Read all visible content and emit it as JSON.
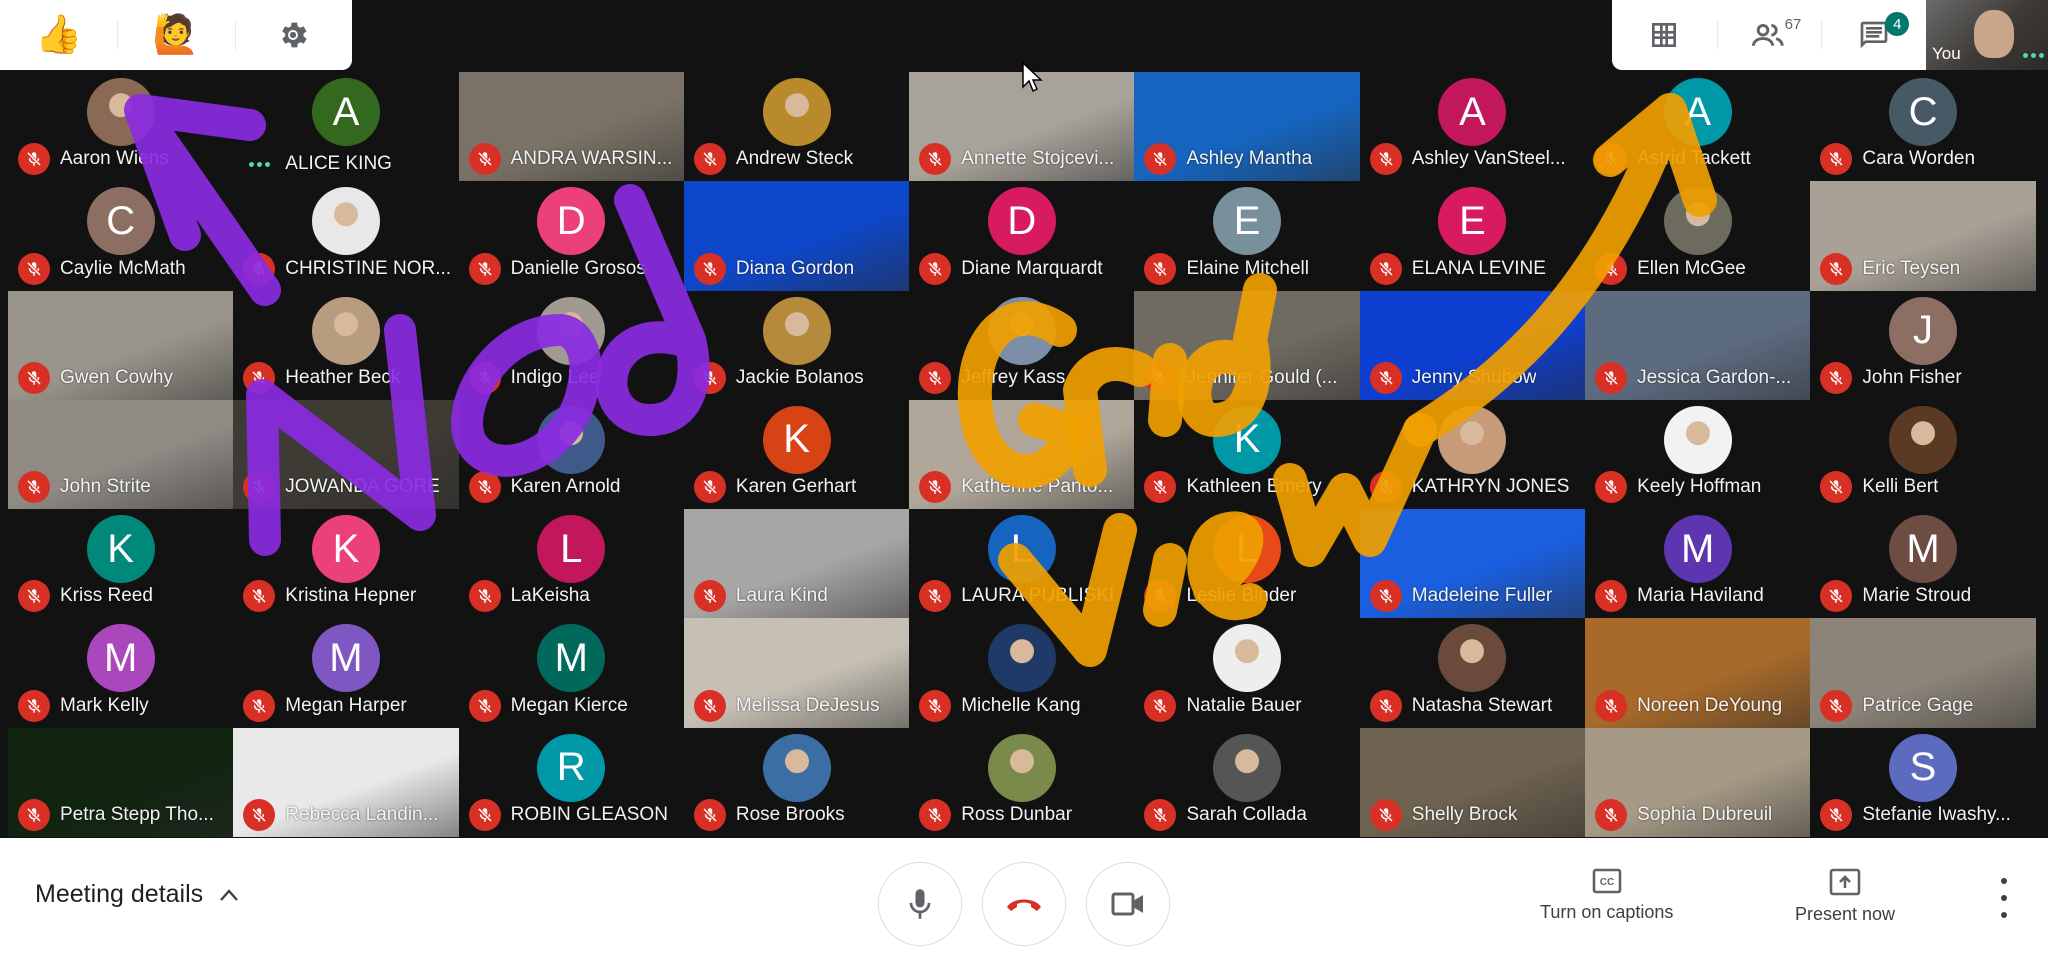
{
  "top_left_toolbar": {
    "buttons": [
      {
        "name": "thumbs-up",
        "glyph": "👍"
      },
      {
        "name": "raise-hand",
        "glyph": "🙋"
      },
      {
        "name": "settings",
        "glyph": "⚙"
      }
    ]
  },
  "top_right_toolbar": {
    "layout_icon": "grid-icon",
    "participants_count": "67",
    "chat_badge": "4",
    "self_label": "You"
  },
  "participants": [
    {
      "name": "Aaron Wiens",
      "type": "avatar-photo",
      "color": "#8a6a55",
      "muted": true
    },
    {
      "name": "ALICE KING",
      "type": "avatar-letter",
      "letter": "A",
      "color": "#33691e",
      "muted": false,
      "speaking": true
    },
    {
      "name": "ANDRA WARSIN...",
      "type": "video",
      "color": "#7a7266",
      "muted": true
    },
    {
      "name": "Andrew Steck",
      "type": "avatar-photo",
      "color": "#b88a2c",
      "muted": true
    },
    {
      "name": "Annette Stojcevi...",
      "type": "video",
      "color": "#a8a39a",
      "muted": true
    },
    {
      "name": "Ashley Mantha",
      "type": "video",
      "color": "#1565c0",
      "muted": true
    },
    {
      "name": "Ashley VanSteel...",
      "type": "avatar-letter",
      "letter": "A",
      "color": "#c2185b",
      "muted": true
    },
    {
      "name": "Astrid Tackett",
      "type": "avatar-letter",
      "letter": "A",
      "color": "#0097a7",
      "muted": true
    },
    {
      "name": "Cara Worden",
      "type": "avatar-letter",
      "letter": "C",
      "color": "#455a64",
      "muted": true
    },
    {
      "name": "Caylie McMath",
      "type": "avatar-letter",
      "letter": "C",
      "color": "#8d6e63",
      "muted": true
    },
    {
      "name": "CHRISTINE NOR...",
      "type": "avatar-photo",
      "color": "#e8e8e8",
      "muted": true
    },
    {
      "name": "Danielle Grosos",
      "type": "avatar-letter",
      "letter": "D",
      "color": "#ec407a",
      "muted": true
    },
    {
      "name": "Diana Gordon",
      "type": "video",
      "color": "#0d47c9",
      "muted": true
    },
    {
      "name": "Diane Marquardt",
      "type": "avatar-letter",
      "letter": "D",
      "color": "#d81b60",
      "muted": true
    },
    {
      "name": "Elaine Mitchell",
      "type": "avatar-letter",
      "letter": "E",
      "color": "#78909c",
      "muted": true
    },
    {
      "name": "ELANA LEVINE",
      "type": "avatar-letter",
      "letter": "E",
      "color": "#d81b60",
      "muted": true
    },
    {
      "name": "Ellen McGee",
      "type": "avatar-photo",
      "color": "#6d6a5e",
      "muted": true
    },
    {
      "name": "Eric Teysen",
      "type": "video",
      "color": "#a9a196",
      "muted": true
    },
    {
      "name": "Gwen Cowhy",
      "type": "video",
      "color": "#9a958c",
      "muted": true
    },
    {
      "name": "Heather Beck",
      "type": "avatar-photo",
      "color": "#b89c80",
      "muted": true
    },
    {
      "name": "Indigo Lee",
      "type": "avatar-photo",
      "color": "#a09a90",
      "muted": true
    },
    {
      "name": "Jackie Bolanos",
      "type": "avatar-photo",
      "color": "#b58a3a",
      "muted": true
    },
    {
      "name": "Jeffrey Kass",
      "type": "avatar-photo",
      "color": "#7d8fa8",
      "muted": true
    },
    {
      "name": "Jennifer Gould (...",
      "type": "video",
      "color": "#6f6a62",
      "muted": true
    },
    {
      "name": "Jenny Shubow",
      "type": "video",
      "color": "#0d3fd1",
      "muted": true
    },
    {
      "name": "Jessica Gardon-...",
      "type": "video",
      "color": "#5d6b80",
      "muted": true
    },
    {
      "name": "John Fisher",
      "type": "avatar-letter",
      "letter": "J",
      "color": "#8d6e63",
      "muted": true
    },
    {
      "name": "John Strite",
      "type": "video",
      "color": "#8f8a84",
      "muted": true
    },
    {
      "name": "JOWANDA GORE",
      "type": "video",
      "color": "#3e3a34",
      "muted": true
    },
    {
      "name": "Karen Arnold",
      "type": "avatar-photo",
      "color": "#3f5a8a",
      "muted": true
    },
    {
      "name": "Karen Gerhart",
      "type": "avatar-letter",
      "letter": "K",
      "color": "#d84315",
      "muted": true
    },
    {
      "name": "Katherine Panto...",
      "type": "video",
      "color": "#b0a79a",
      "muted": true
    },
    {
      "name": "Kathleen Emery",
      "type": "avatar-letter",
      "letter": "K",
      "color": "#0097a7",
      "muted": true
    },
    {
      "name": "KATHRYN JONES",
      "type": "avatar-photo",
      "color": "#c79a78",
      "muted": true
    },
    {
      "name": "Keely Hoffman",
      "type": "avatar-photo",
      "color": "#f2f2f2",
      "muted": true
    },
    {
      "name": "Kelli Bert",
      "type": "avatar-photo",
      "color": "#5a3a22",
      "muted": true
    },
    {
      "name": "Kriss Reed",
      "type": "avatar-letter",
      "letter": "K",
      "color": "#00897b",
      "muted": true
    },
    {
      "name": "Kristina Hepner",
      "type": "avatar-letter",
      "letter": "K",
      "color": "#ec407a",
      "muted": true
    },
    {
      "name": "LaKeisha",
      "type": "avatar-letter",
      "letter": "L",
      "color": "#c2185b",
      "muted": true
    },
    {
      "name": "Laura Kind",
      "type": "video",
      "color": "#a7a6a4",
      "muted": true
    },
    {
      "name": "LAURA PUBLISKI",
      "type": "avatar-letter",
      "letter": "L",
      "color": "#1565c0",
      "muted": true
    },
    {
      "name": "Leslie Binder",
      "type": "avatar-letter",
      "letter": "L",
      "color": "#e64a19",
      "muted": true
    },
    {
      "name": "Madeleine Fuller",
      "type": "video",
      "color": "#1a5fe0",
      "muted": true
    },
    {
      "name": "Maria Haviland",
      "type": "avatar-letter",
      "letter": "M",
      "color": "#5e35b1",
      "muted": true
    },
    {
      "name": "Marie Stroud",
      "type": "avatar-letter",
      "letter": "M",
      "color": "#6d4c41",
      "muted": true
    },
    {
      "name": "Mark Kelly",
      "type": "avatar-letter",
      "letter": "M",
      "color": "#ab47bc",
      "muted": true
    },
    {
      "name": "Megan Harper",
      "type": "avatar-letter",
      "letter": "M",
      "color": "#7e57c2",
      "muted": true
    },
    {
      "name": "Megan Kierce",
      "type": "avatar-letter",
      "letter": "M",
      "color": "#00695c",
      "muted": true
    },
    {
      "name": "Melissa DeJesus",
      "type": "video",
      "color": "#c6c0b4",
      "muted": true
    },
    {
      "name": "Michelle Kang",
      "type": "avatar-photo",
      "color": "#1f3a66",
      "muted": true
    },
    {
      "name": "Natalie Bauer",
      "type": "avatar-photo",
      "color": "#eeeeee",
      "muted": true
    },
    {
      "name": "Natasha Stewart",
      "type": "avatar-photo",
      "color": "#6a4a3a",
      "muted": true
    },
    {
      "name": "Noreen DeYoung",
      "type": "video",
      "color": "#a86a2a",
      "muted": true
    },
    {
      "name": "Patrice Gage",
      "type": "video",
      "color": "#8c8478",
      "muted": true
    },
    {
      "name": "Petra Stepp Tho...",
      "type": "video",
      "color": "#102410",
      "muted": true
    },
    {
      "name": "Rebecca Landin...",
      "type": "video",
      "color": "#e9e9e9",
      "muted": true
    },
    {
      "name": "ROBIN GLEASON",
      "type": "avatar-letter",
      "letter": "R",
      "color": "#0097a7",
      "muted": true
    },
    {
      "name": "Rose Brooks",
      "type": "avatar-photo",
      "color": "#3a6ea5",
      "muted": true
    },
    {
      "name": "Ross Dunbar",
      "type": "avatar-photo",
      "color": "#7a8a4a",
      "muted": true
    },
    {
      "name": "Sarah Collada",
      "type": "avatar-photo",
      "color": "#555555",
      "muted": true
    },
    {
      "name": "Shelly Brock",
      "type": "video",
      "color": "#6e6250",
      "muted": true
    },
    {
      "name": "Sophia Dubreuil",
      "type": "video",
      "color": "#a69a86",
      "muted": true
    },
    {
      "name": "Stefanie Iwashy...",
      "type": "avatar-letter",
      "letter": "S",
      "color": "#5c6bc0",
      "muted": true
    }
  ],
  "bottom_bar": {
    "meeting_details_label": "Meeting details",
    "captions_label": "Turn on captions",
    "present_label": "Present now"
  },
  "annotations": {
    "left_text": "Nod",
    "left_color": "#8a2be2",
    "right_text": "Grid View",
    "right_color": "#f0a000"
  },
  "colors": {
    "mute_red": "#d93025",
    "end_call_red": "#d93025",
    "badge_green": "#00796b",
    "speaking_teal": "#4ed6b5"
  }
}
